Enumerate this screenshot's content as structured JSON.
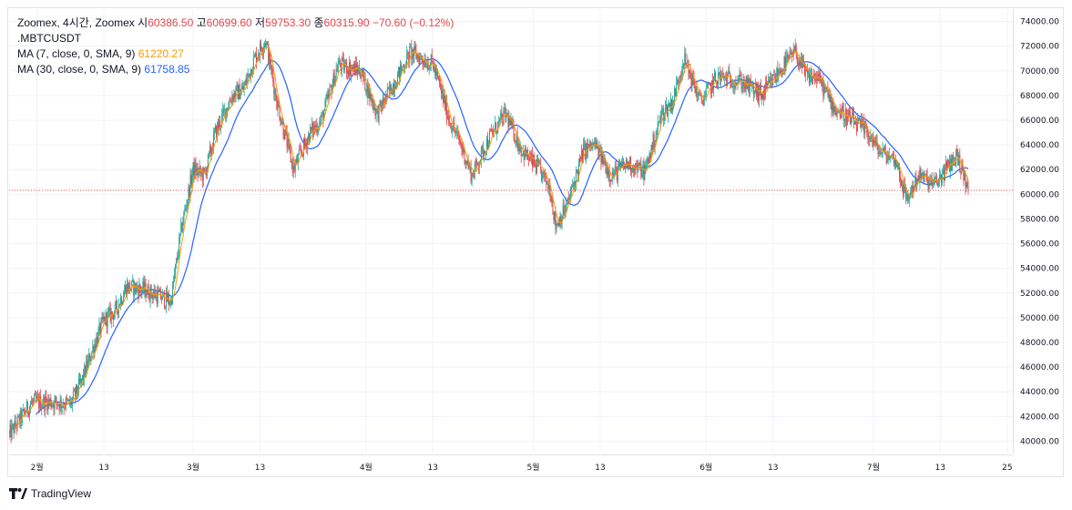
{
  "legend": {
    "symbol_line": "Zoomex, 4시간, Zoomex",
    "o_label": "시",
    "o_value": "60386.50",
    "h_label": "고",
    "h_value": "60699.60",
    "l_label": "저",
    "l_value": "59753.30",
    "c_label": "종",
    "c_value": "60315.90",
    "change": "−70.60 (−0.12%)",
    "ticker": ".MBTCUSDT",
    "ma7_label": "MA (7, close, 0, SMA, 9)",
    "ma7_value": "61220.27",
    "ma30_label": "MA (30, close, 0, SMA, 9)",
    "ma30_value": "61758.85"
  },
  "colors": {
    "up": "#26a69a",
    "down": "#e5464b",
    "ma7": "#ff9800",
    "ma30": "#2962ff",
    "grid": "#f0f3fa",
    "last_price_line": "#e5464b"
  },
  "branding": {
    "logo_icon": "tradingview-logo-icon",
    "text": "TradingView"
  },
  "chart_data": {
    "type": "candlestick",
    "interval": "4시간",
    "ylim": [
      39000,
      75000
    ],
    "y_ticks": [
      "40000.00",
      "42000.00",
      "44000.00",
      "46000.00",
      "48000.00",
      "50000.00",
      "52000.00",
      "54000.00",
      "56000.00",
      "58000.00",
      "60000.00",
      "62000.00",
      "64000.00",
      "66000.00",
      "68000.00",
      "70000.00",
      "72000.00",
      "74000.00"
    ],
    "x_ticks": [
      "2월",
      "13",
      "3월",
      "13",
      "4월",
      "13",
      "5월",
      "13",
      "6월",
      "13",
      "7월",
      "13",
      "25"
    ],
    "x_tick_days": [
      1,
      13,
      29,
      41,
      60,
      72,
      90,
      102,
      121,
      133,
      151,
      163,
      175
    ],
    "x_range_days": [
      -4,
      176
    ],
    "last_price": 60315.9,
    "close_anchors": [
      {
        "day": -4,
        "price": 40500
      },
      {
        "day": 0,
        "price": 43100
      },
      {
        "day": 3,
        "price": 43200
      },
      {
        "day": 7,
        "price": 43000
      },
      {
        "day": 9,
        "price": 44800
      },
      {
        "day": 11,
        "price": 47500
      },
      {
        "day": 13,
        "price": 49800
      },
      {
        "day": 15,
        "price": 50500
      },
      {
        "day": 17,
        "price": 52500
      },
      {
        "day": 20,
        "price": 52300
      },
      {
        "day": 25,
        "price": 51300
      },
      {
        "day": 27,
        "price": 57500
      },
      {
        "day": 29,
        "price": 62000
      },
      {
        "day": 31,
        "price": 61500
      },
      {
        "day": 33,
        "price": 65000
      },
      {
        "day": 36,
        "price": 68000
      },
      {
        "day": 38,
        "price": 68500
      },
      {
        "day": 40,
        "price": 71000
      },
      {
        "day": 42,
        "price": 72500
      },
      {
        "day": 44,
        "price": 67500
      },
      {
        "day": 47,
        "price": 62000
      },
      {
        "day": 50,
        "price": 65000
      },
      {
        "day": 52,
        "price": 66000
      },
      {
        "day": 55,
        "price": 70500
      },
      {
        "day": 59,
        "price": 70000
      },
      {
        "day": 62,
        "price": 66500
      },
      {
        "day": 65,
        "price": 69000
      },
      {
        "day": 68,
        "price": 71500
      },
      {
        "day": 72,
        "price": 70500
      },
      {
        "day": 75,
        "price": 66000
      },
      {
        "day": 77,
        "price": 64000
      },
      {
        "day": 79,
        "price": 61500
      },
      {
        "day": 82,
        "price": 64500
      },
      {
        "day": 85,
        "price": 66500
      },
      {
        "day": 88,
        "price": 63500
      },
      {
        "day": 91,
        "price": 62000
      },
      {
        "day": 93,
        "price": 60500
      },
      {
        "day": 94,
        "price": 57500
      },
      {
        "day": 96,
        "price": 59000
      },
      {
        "day": 99,
        "price": 63500
      },
      {
        "day": 101,
        "price": 64000
      },
      {
        "day": 104,
        "price": 61500
      },
      {
        "day": 107,
        "price": 62500
      },
      {
        "day": 110,
        "price": 61800
      },
      {
        "day": 113,
        "price": 66500
      },
      {
        "day": 115,
        "price": 67500
      },
      {
        "day": 117,
        "price": 71000
      },
      {
        "day": 120,
        "price": 67500
      },
      {
        "day": 123,
        "price": 69500
      },
      {
        "day": 127,
        "price": 69200
      },
      {
        "day": 131,
        "price": 68000
      },
      {
        "day": 135,
        "price": 70500
      },
      {
        "day": 137,
        "price": 71500
      },
      {
        "day": 139,
        "price": 69500
      },
      {
        "day": 141,
        "price": 69500
      },
      {
        "day": 144,
        "price": 67000
      },
      {
        "day": 147,
        "price": 66000
      },
      {
        "day": 150,
        "price": 65000
      },
      {
        "day": 152,
        "price": 63500
      },
      {
        "day": 155,
        "price": 62800
      },
      {
        "day": 157,
        "price": 59500
      },
      {
        "day": 159,
        "price": 61500
      },
      {
        "day": 162,
        "price": 60800
      },
      {
        "day": 164,
        "price": 62000
      },
      {
        "day": 166,
        "price": 63200
      },
      {
        "day": 167,
        "price": 61800
      },
      {
        "day": 168,
        "price": 60316
      }
    ]
  }
}
